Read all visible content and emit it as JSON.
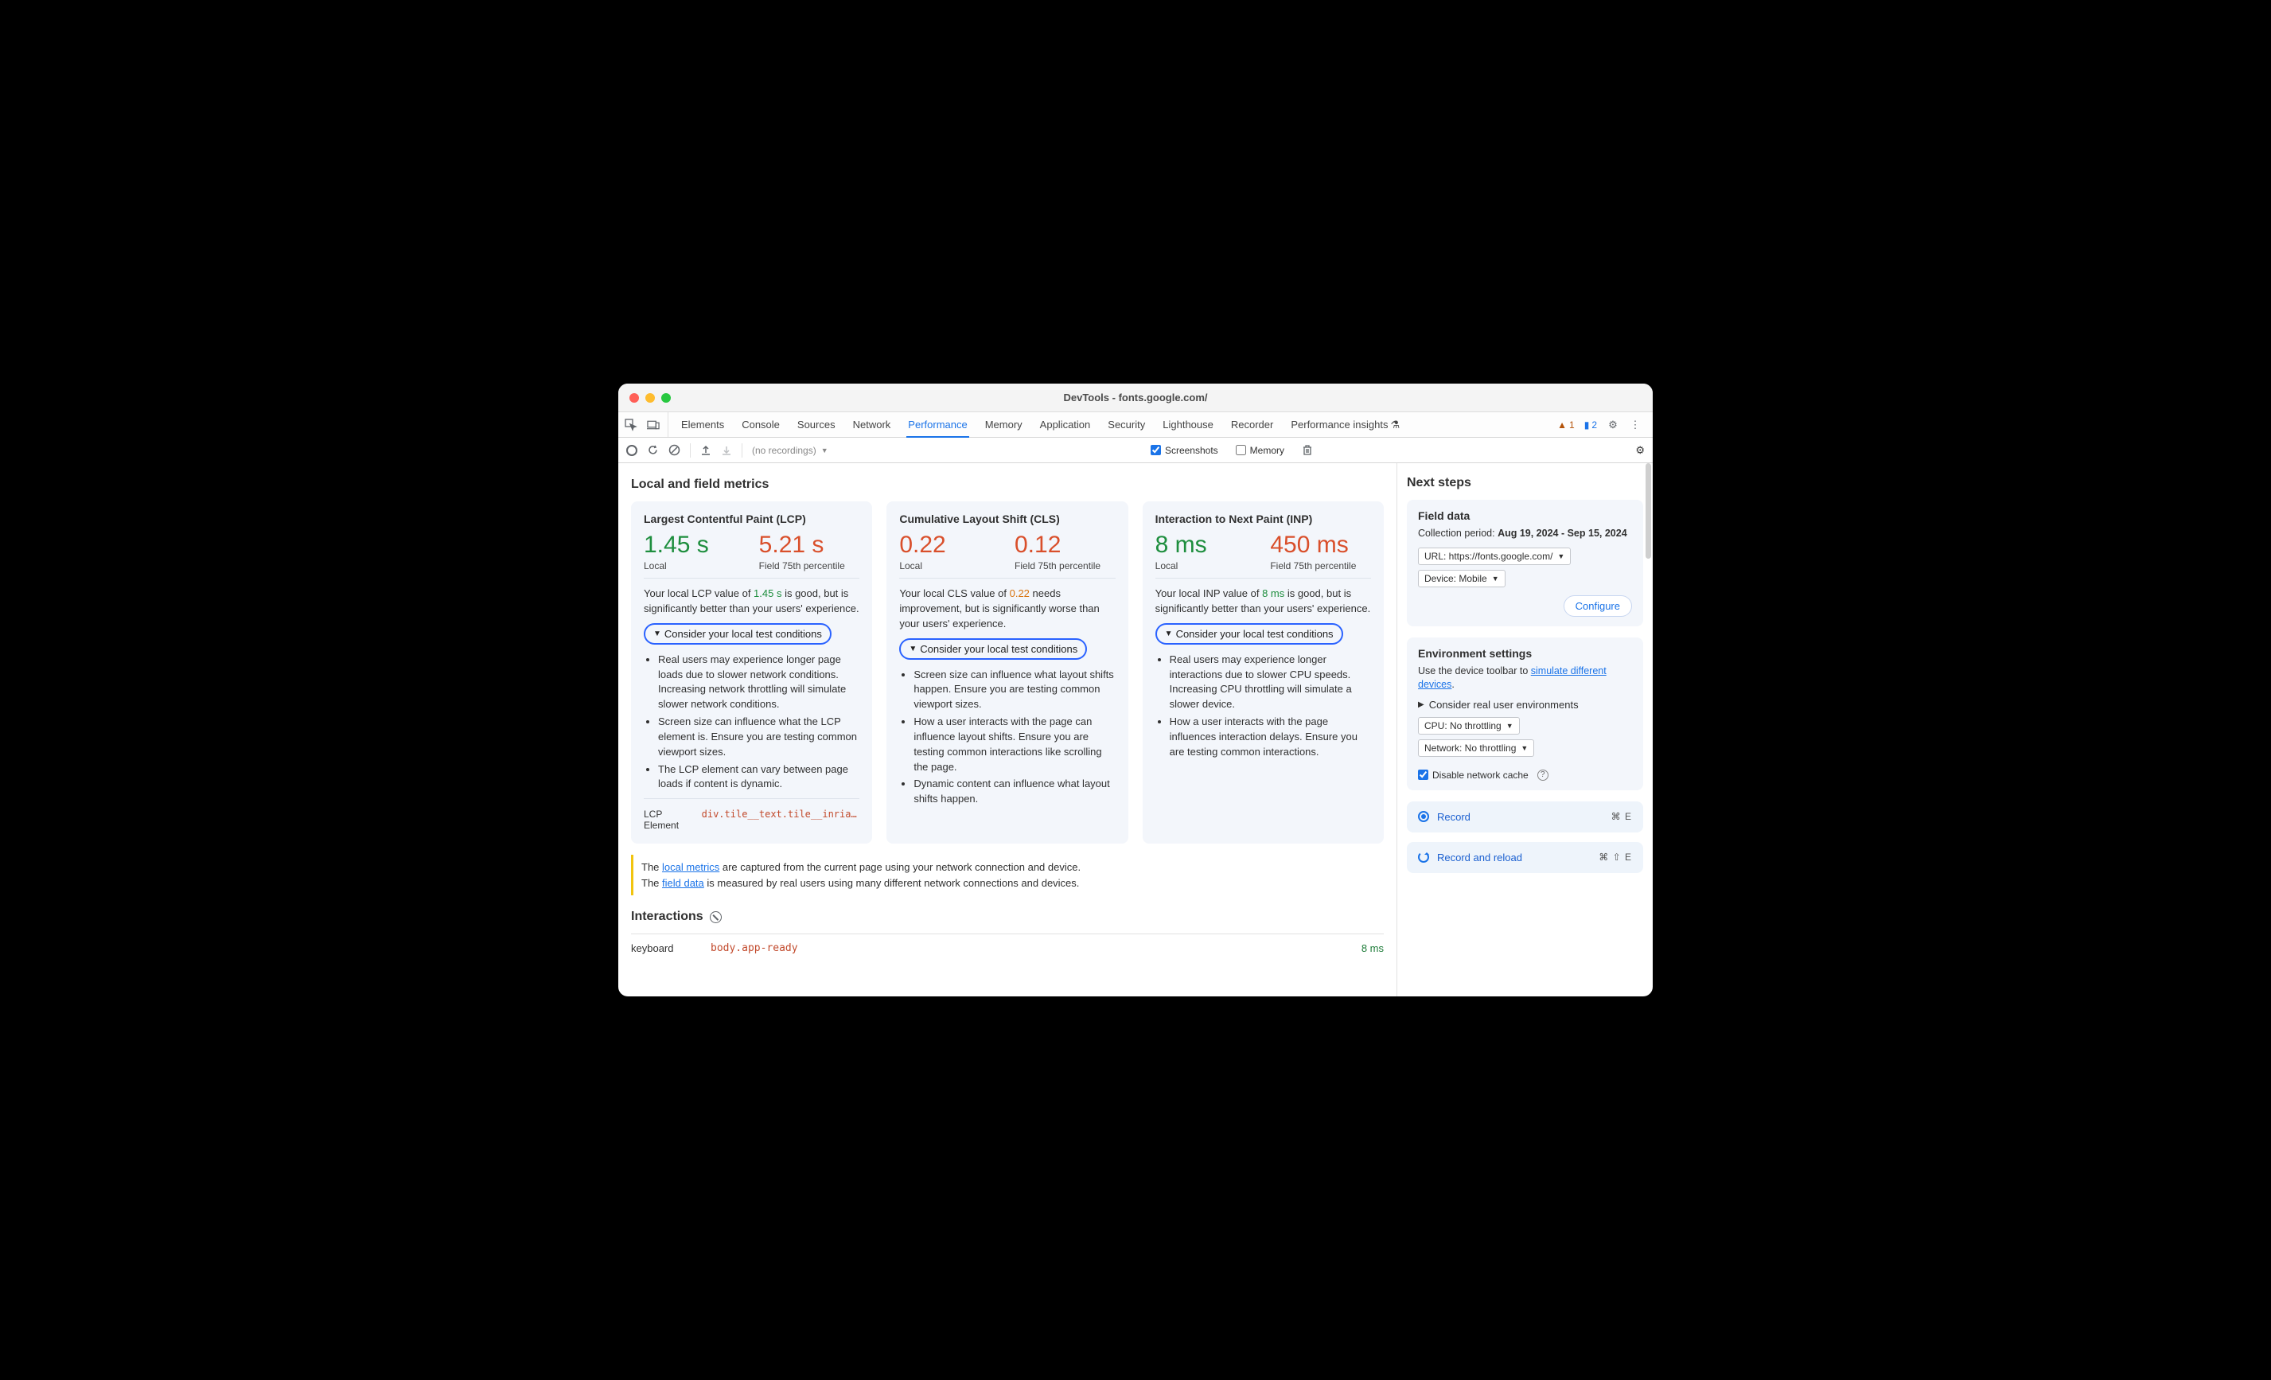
{
  "window": {
    "title": "DevTools - fonts.google.com/"
  },
  "tabs": {
    "elements": "Elements",
    "console": "Console",
    "sources": "Sources",
    "network": "Network",
    "performance": "Performance",
    "memory": "Memory",
    "application": "Application",
    "security": "Security",
    "lighthouse": "Lighthouse",
    "recorder": "Recorder",
    "insights": "Performance insights"
  },
  "status": {
    "warn_count": "1",
    "chat_count": "2"
  },
  "toolbar": {
    "no_recordings": "(no recordings)",
    "screenshots": "Screenshots",
    "memory": "Memory"
  },
  "main": {
    "heading": "Local and field metrics",
    "lcp": {
      "title": "Largest Contentful Paint (LCP)",
      "local_val": "1.45 s",
      "local_label": "Local",
      "field_val": "5.21 s",
      "field_label": "Field 75th percentile",
      "desc_pre": "Your local LCP value of ",
      "desc_val": "1.45 s",
      "desc_post": " is good, but is significantly better than your users' experience.",
      "expand_label": "Consider your local test conditions",
      "bullets": [
        "Real users may experience longer page loads due to slower network conditions. Increasing network throttling will simulate slower network conditions.",
        "Screen size can influence what the LCP element is. Ensure you are testing common viewport sizes.",
        "The LCP element can vary between page loads if content is dynamic."
      ],
      "elem_label": "LCP Element",
      "elem_sel": "div.tile__text.tile__inria_san"
    },
    "cls": {
      "title": "Cumulative Layout Shift (CLS)",
      "local_val": "0.22",
      "local_label": "Local",
      "field_val": "0.12",
      "field_label": "Field 75th percentile",
      "desc_pre": "Your local CLS value of ",
      "desc_val": "0.22",
      "desc_post": " needs improvement, but is significantly worse than your users' experience.",
      "expand_label": "Consider your local test conditions",
      "bullets": [
        "Screen size can influence what layout shifts happen. Ensure you are testing common viewport sizes.",
        "How a user interacts with the page can influence layout shifts. Ensure you are testing common interactions like scrolling the page.",
        "Dynamic content can influence what layout shifts happen."
      ]
    },
    "inp": {
      "title": "Interaction to Next Paint (INP)",
      "local_val": "8 ms",
      "local_label": "Local",
      "field_val": "450 ms",
      "field_label": "Field 75th percentile",
      "desc_pre": "Your local INP value of ",
      "desc_val": "8 ms",
      "desc_post": " is good, but is significantly better than your users' experience.",
      "expand_label": "Consider your local test conditions",
      "bullets": [
        "Real users may experience longer interactions due to slower CPU speeds. Increasing CPU throttling will simulate a slower device.",
        "How a user interacts with the page influences interaction delays. Ensure you are testing common interactions."
      ]
    },
    "note": {
      "pre": "The ",
      "link1": "local metrics",
      "mid": " are captured from the current page using your network connection and device.",
      "pre2": "The ",
      "link2": "field data",
      "post2": " is measured by real users using many different network connections and devices."
    },
    "interactions": {
      "heading": "Interactions",
      "row": {
        "kind": "keyboard",
        "sel": "body.app-ready",
        "time": "8 ms"
      }
    }
  },
  "side": {
    "heading": "Next steps",
    "field": {
      "title": "Field data",
      "period_label": "Collection period: ",
      "period_val": "Aug 19, 2024 - Sep 15, 2024",
      "url_dd": "URL: https://fonts.google.com/",
      "device_dd": "Device: Mobile",
      "configure": "Configure"
    },
    "env": {
      "title": "Environment settings",
      "desc_pre": "Use the device toolbar to ",
      "desc_link": "simulate different devices",
      "desc_post": ".",
      "expand_label": "Consider real user environments",
      "cpu_dd": "CPU: No throttling",
      "net_dd": "Network: No throttling",
      "disable_cache": "Disable network cache"
    },
    "actions": {
      "record": "Record",
      "record_kb": "⌘ E",
      "reload": "Record and reload",
      "reload_kb": "⌘ ⇧ E"
    }
  }
}
